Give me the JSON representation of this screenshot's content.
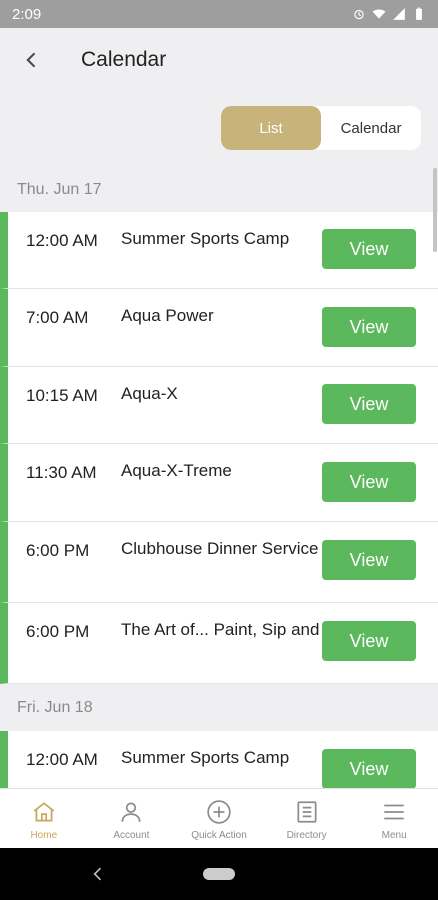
{
  "status_bar": {
    "time": "2:09"
  },
  "header": {
    "title": "Calendar"
  },
  "toggle": {
    "list_label": "List",
    "calendar_label": "Calendar"
  },
  "days": [
    {
      "date": "Thu. Jun 17",
      "events": [
        {
          "time": "12:00 AM",
          "name": "Summer Sports Camp",
          "action": "View"
        },
        {
          "time": "7:00 AM",
          "name": "Aqua Power",
          "action": "View"
        },
        {
          "time": "10:15 AM",
          "name": "Aqua-X",
          "action": "View"
        },
        {
          "time": "11:30 AM",
          "name": "Aqua-X-Treme",
          "action": "View"
        },
        {
          "time": "6:00 PM",
          "name": "Clubhouse Dinner Service",
          "action": "View"
        },
        {
          "time": "6:00 PM",
          "name": "The Art of... Paint, Sip and Swirl",
          "action": "View"
        }
      ]
    },
    {
      "date": "Fri. Jun 18",
      "events": [
        {
          "time": "12:00 AM",
          "name": "Summer Sports Camp",
          "action": "View"
        }
      ]
    }
  ],
  "bottom_nav": [
    {
      "label": "Home",
      "icon": "home-icon",
      "active": true
    },
    {
      "label": "Account",
      "icon": "account-icon",
      "active": false
    },
    {
      "label": "Quick Action",
      "icon": "plus-circle-icon",
      "active": false
    },
    {
      "label": "Directory",
      "icon": "directory-icon",
      "active": false
    },
    {
      "label": "Menu",
      "icon": "menu-icon",
      "active": false
    }
  ],
  "colors": {
    "accent_gold": "#c8b37a",
    "event_green": "#5cb85c",
    "background": "#efeff1"
  }
}
